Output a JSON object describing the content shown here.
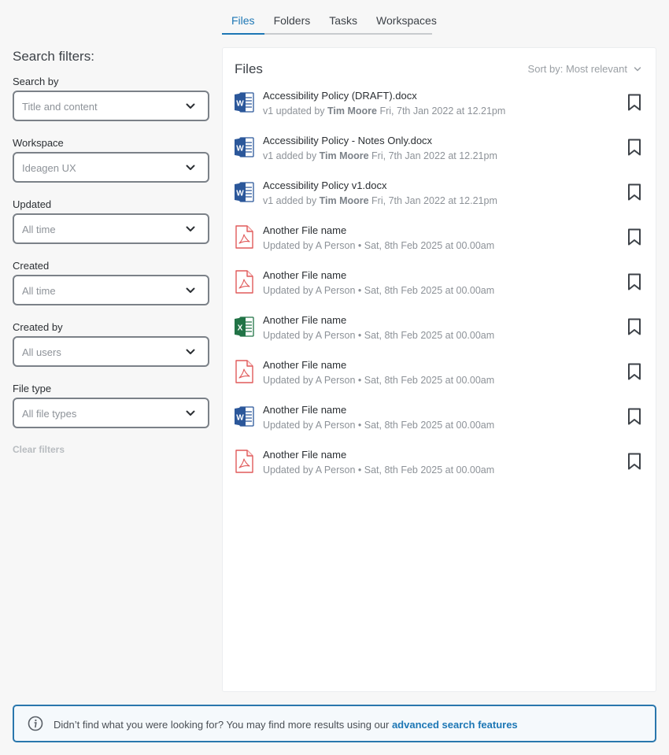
{
  "tabs": [
    {
      "label": "Files",
      "active": true
    },
    {
      "label": "Folders"
    },
    {
      "label": "Tasks"
    },
    {
      "label": "Workspaces"
    }
  ],
  "filters": {
    "title": "Search filters:",
    "fields": [
      {
        "label": "Search by",
        "value": "Title and content"
      },
      {
        "label": "Workspace",
        "value": "Ideagen UX"
      },
      {
        "label": "Updated",
        "value": "All time"
      },
      {
        "label": "Created",
        "value": "All time"
      },
      {
        "label": "Created by",
        "value": "All users"
      },
      {
        "label": "File type",
        "value": "All file types"
      }
    ],
    "clear_label": "Clear filters"
  },
  "results": {
    "title": "Files",
    "sort_label": "Sort by: Most relevant",
    "items": [
      {
        "type": "word",
        "name": "Accessibility Policy (DRAFT).docx",
        "meta_prefix": "v1 updated by ",
        "meta_user": "Tim Moore",
        "meta_suffix": " Fri, 7th Jan 2022 at 12.21pm"
      },
      {
        "type": "word",
        "name": "Accessibility Policy - Notes Only.docx",
        "meta_prefix": "v1 added by ",
        "meta_user": "Tim Moore",
        "meta_suffix": " Fri, 7th Jan 2022 at 12.21pm"
      },
      {
        "type": "word",
        "name": "Accessibility Policy v1.docx",
        "meta_prefix": "v1 added by ",
        "meta_user": "Tim Moore",
        "meta_suffix": " Fri, 7th Jan 2022 at 12.21pm"
      },
      {
        "type": "pdf",
        "name": "Another File name",
        "meta_prefix": "Updated by A Person • Sat, 8th Feb 2025 at 00.00am",
        "meta_user": "",
        "meta_suffix": ""
      },
      {
        "type": "pdf",
        "name": "Another File name",
        "meta_prefix": "Updated by A Person • Sat, 8th Feb 2025 at 00.00am",
        "meta_user": "",
        "meta_suffix": ""
      },
      {
        "type": "excel",
        "name": "Another File name",
        "meta_prefix": "Updated by A Person • Sat, 8th Feb 2025 at 00.00am",
        "meta_user": "",
        "meta_suffix": ""
      },
      {
        "type": "pdf",
        "name": "Another File name",
        "meta_prefix": "Updated by A Person • Sat, 8th Feb 2025 at 00.00am",
        "meta_user": "",
        "meta_suffix": ""
      },
      {
        "type": "word",
        "name": "Another File name",
        "meta_prefix": "Updated by A Person • Sat, 8th Feb 2025 at 00.00am",
        "meta_user": "",
        "meta_suffix": ""
      },
      {
        "type": "pdf",
        "name": "Another File name",
        "meta_prefix": "Updated by A Person • Sat, 8th Feb 2025 at 00.00am",
        "meta_user": "",
        "meta_suffix": ""
      }
    ]
  },
  "notice": {
    "text": "Didn’t find what you were looking for? You may find more results using our ",
    "link": "advanced search features"
  },
  "colors": {
    "accent": "#1d77b5",
    "word": "#2b579a",
    "excel": "#217346",
    "pdf": "#e05a5a"
  },
  "icons": {
    "word": "word-file-icon",
    "excel": "excel-file-icon",
    "pdf": "pdf-file-icon",
    "bookmark": "bookmark-icon",
    "info": "info-icon",
    "chevron": "chevron-down-icon"
  }
}
